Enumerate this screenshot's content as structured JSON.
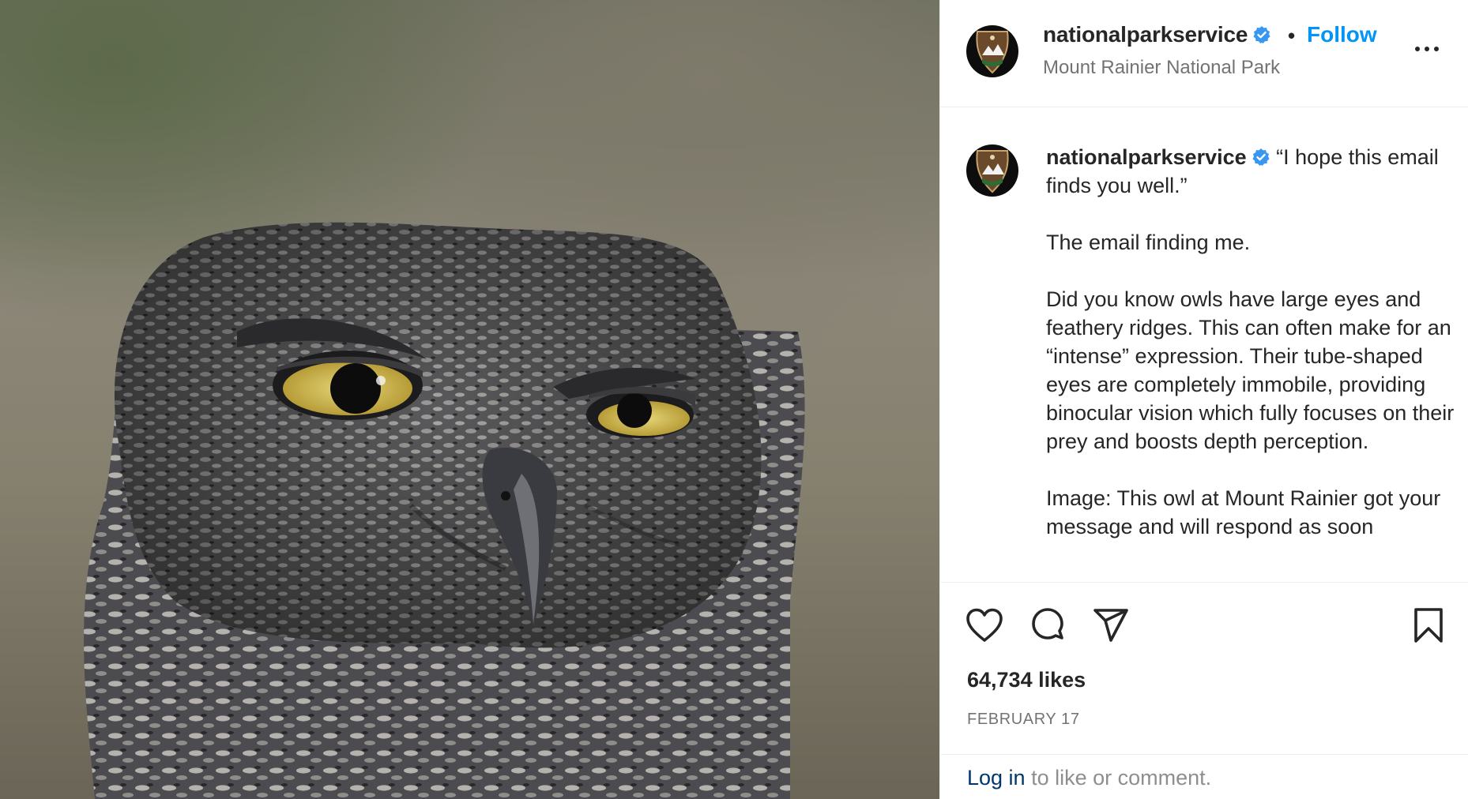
{
  "post": {
    "photo_alt": "owl-photo",
    "header": {
      "username": "nationalparkservice",
      "separator": "•",
      "follow_label": "Follow",
      "location": "Mount Rainier National Park"
    },
    "caption": {
      "username": "nationalparkservice",
      "paragraphs": [
        "“I hope this email finds you well.”",
        "The email finding me.",
        "Did you know owls have large eyes and feathery ridges. This can often make for an “intense” expression. Their tube-shaped eyes are completely immobile, providing binocular vision which fully focuses on their prey and boosts depth perception.",
        "Image: This owl at Mount Rainier got your message and will respond as soon"
      ]
    },
    "likes": "64,734 likes",
    "date": "FEBRUARY 17",
    "login": {
      "link": "Log in",
      "rest": " to like or comment."
    }
  },
  "colors": {
    "accent": "#0095f6",
    "verified": "#3897f0",
    "text": "#262626",
    "muted": "#737373",
    "link_dark": "#00376b"
  },
  "icons": [
    "verified-badge-icon",
    "more-options-icon",
    "heart-icon",
    "comment-icon",
    "share-icon",
    "bookmark-icon"
  ]
}
